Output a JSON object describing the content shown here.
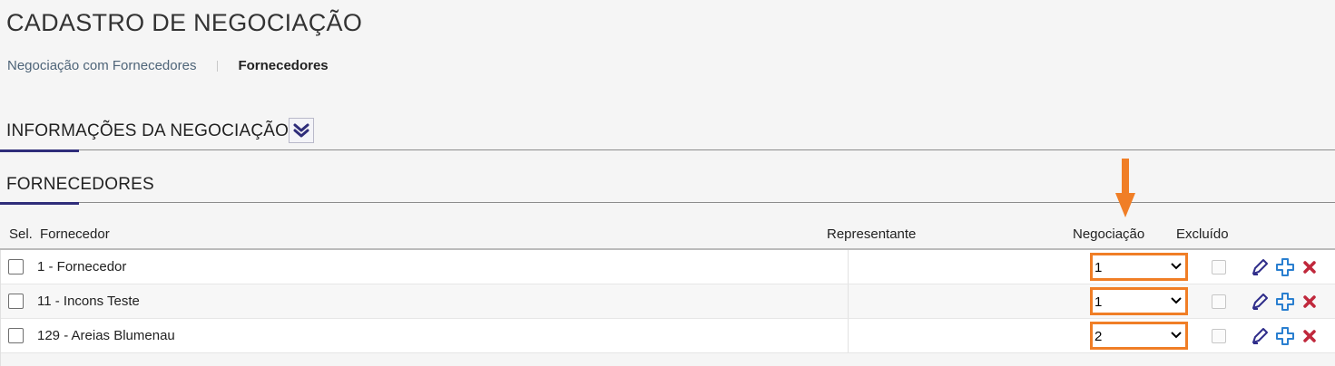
{
  "page": {
    "title": "CADASTRO DE NEGOCIAÇÃO"
  },
  "breadcrumb": {
    "link": "Negociação com Fornecedores",
    "current": "Fornecedores"
  },
  "sections": {
    "info": {
      "title": "INFORMAÇÕES DA NEGOCIAÇÃO"
    },
    "suppliers": {
      "title": "FORNECEDORES"
    }
  },
  "table": {
    "headers": {
      "sel": "Sel.",
      "fornecedor": "Fornecedor",
      "representante": "Representante",
      "negociacao": "Negociação",
      "excluido": "Excluído"
    },
    "rows": [
      {
        "fornecedor": "1 - Fornecedor",
        "representante": "",
        "negociacao": "1",
        "selected": false,
        "excluido": false
      },
      {
        "fornecedor": "11 - Incons Teste",
        "representante": "",
        "negociacao": "1",
        "selected": false,
        "excluido": false
      },
      {
        "fornecedor": "129 - Areias Blumenau",
        "representante": "",
        "negociacao": "2",
        "selected": false,
        "excluido": false
      }
    ]
  },
  "colors": {
    "accent": "#2f2d7a",
    "highlight": "#f07e26",
    "edit_icon": "#2f2d8a",
    "add_icon": "#2a7fd0",
    "delete_icon": "#c0283c"
  },
  "icons": {
    "collapse": "double-chevron-down-icon",
    "edit": "pencil-icon",
    "add": "plus-icon",
    "delete": "x-icon",
    "marker": "arrow-down-icon"
  }
}
